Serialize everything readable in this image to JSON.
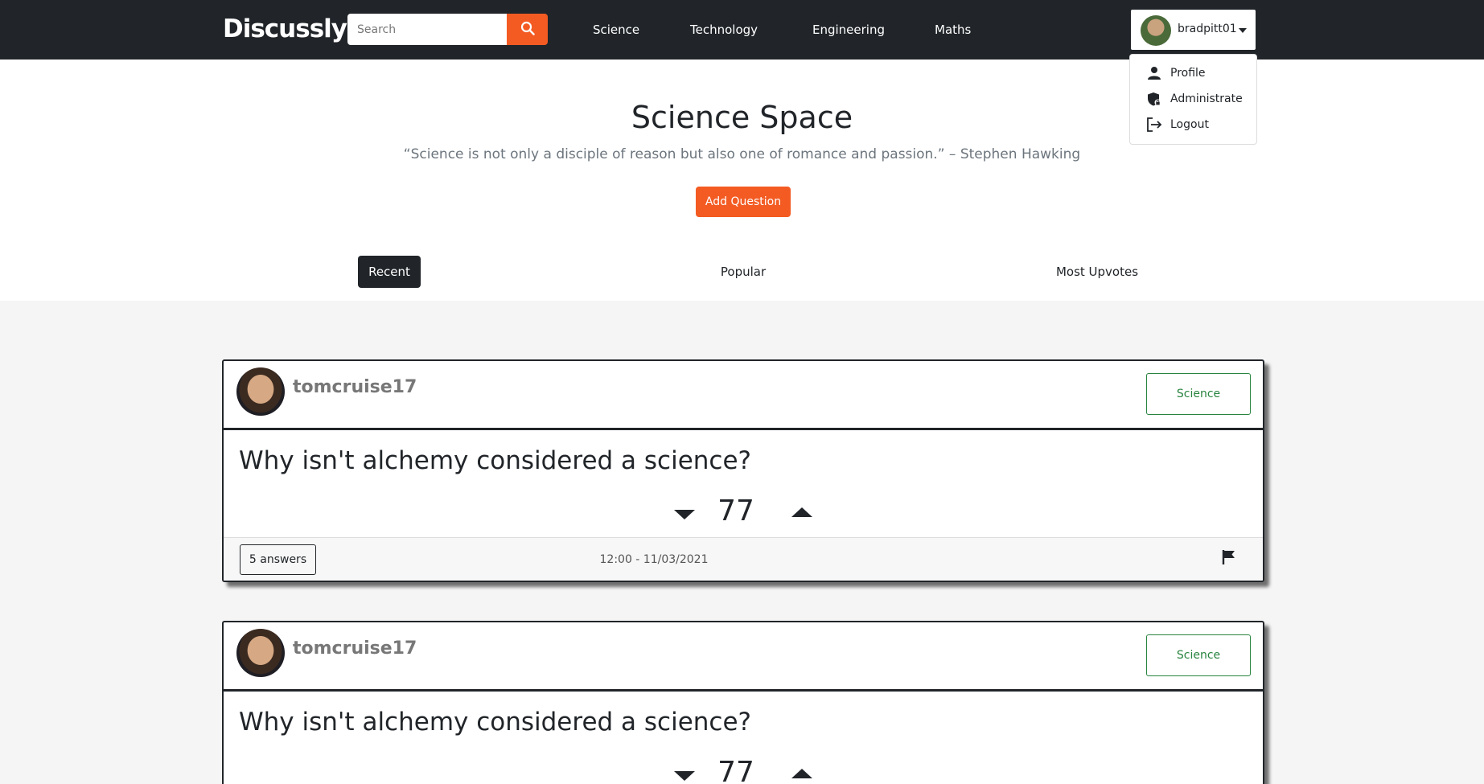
{
  "brand": "Discussly",
  "search": {
    "placeholder": "Search"
  },
  "nav": {
    "links": [
      "Science",
      "Technology",
      "Engineering",
      "Maths"
    ]
  },
  "user": {
    "name": "bradpitt01"
  },
  "dropdown": {
    "items": [
      "Profile",
      "Administrate",
      "Logout"
    ]
  },
  "header": {
    "title": "Science Space",
    "quote": "“Science is not only a disciple of reason but also one of romance and passion.” – Stephen Hawking",
    "add_button": "Add Question"
  },
  "tabs": [
    "Recent",
    "Popular",
    "Most Upvotes"
  ],
  "questions": [
    {
      "user": "tomcruise17",
      "tag": "Science",
      "title": "Why isn't alchemy considered a science?",
      "votes": "77",
      "answers": "5 answers",
      "time": "12:00 - 11/03/2021"
    },
    {
      "user": "tomcruise17",
      "tag": "Science",
      "title": "Why isn't alchemy considered a science?",
      "votes": "77"
    }
  ],
  "colors": {
    "navbar": "#212529",
    "accent": "#f35b23",
    "tag": "#28843f"
  }
}
